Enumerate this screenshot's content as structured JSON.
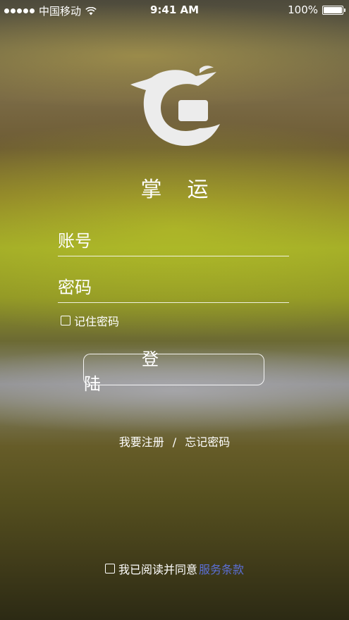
{
  "status_bar": {
    "carrier": "中国移动",
    "time": "9:41 AM",
    "battery": "100%",
    "signal_icon": "signal-dots-icon",
    "wifi_icon": "wifi-icon",
    "battery_icon": "battery-icon"
  },
  "logo": {
    "icon": "logo-icon"
  },
  "app_title": "掌运",
  "form": {
    "account_label": "账号",
    "account_value": "",
    "password_label": "密码",
    "password_value": "",
    "remember_label": "记住密码"
  },
  "login_button_label": "登陆",
  "links": {
    "register": "我要注册",
    "separator": "/",
    "forgot": "忘记密码"
  },
  "agreement": {
    "text": "我已阅读并同意",
    "terms_link": "服务条款",
    "terms_color": "#5b6fd6"
  }
}
